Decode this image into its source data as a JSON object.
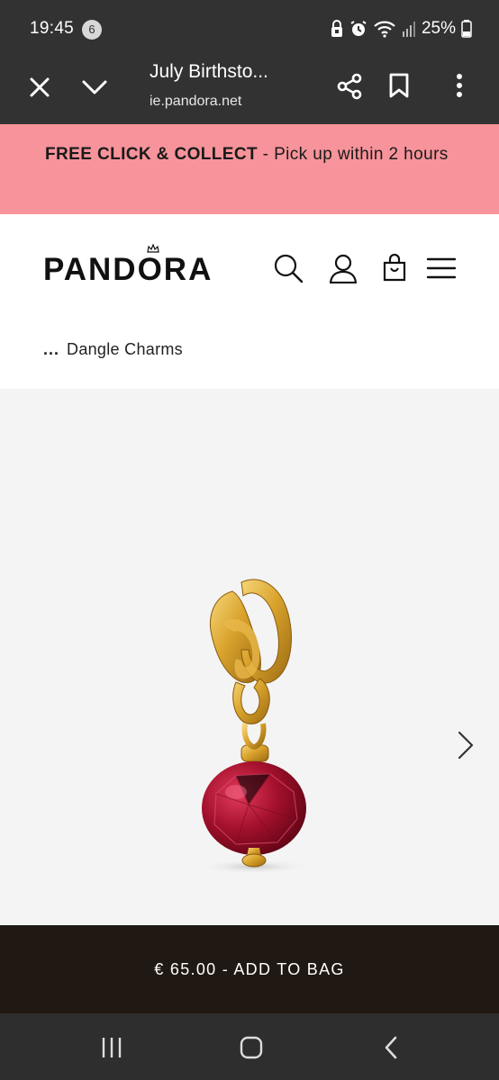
{
  "status_bar": {
    "time": "19:45",
    "notification_count": "6",
    "battery": "25%",
    "icons": [
      "vpn-icon",
      "alarm-icon",
      "wifi-icon",
      "signal-icon",
      "battery-icon"
    ]
  },
  "browser": {
    "page_title": "July Birthsto...",
    "url": "ie.pandora.net",
    "icons": [
      "close-icon",
      "chevron-down-icon",
      "share-icon",
      "bookmark-icon",
      "more-vert-icon"
    ]
  },
  "promo": {
    "bold_text": "FREE CLICK & COLLECT",
    "rest_text": " - Pick up within 2 hours",
    "background": "#f7939a"
  },
  "header": {
    "logo_text": "PANDŌRA",
    "icons": [
      "search-icon",
      "account-icon",
      "bag-icon",
      "menu-icon"
    ]
  },
  "breadcrumb": {
    "ellipsis": "...",
    "current": "Dangle Charms"
  },
  "product": {
    "image_alt": "gold-dangle-charm-with-red-stone",
    "gallery_next_icon": "chevron-right-icon"
  },
  "cta": {
    "label": "€ 65.00 - ADD TO BAG",
    "background": "#201812"
  },
  "system_nav": {
    "icons": [
      "recents-icon",
      "home-icon",
      "back-icon"
    ]
  }
}
